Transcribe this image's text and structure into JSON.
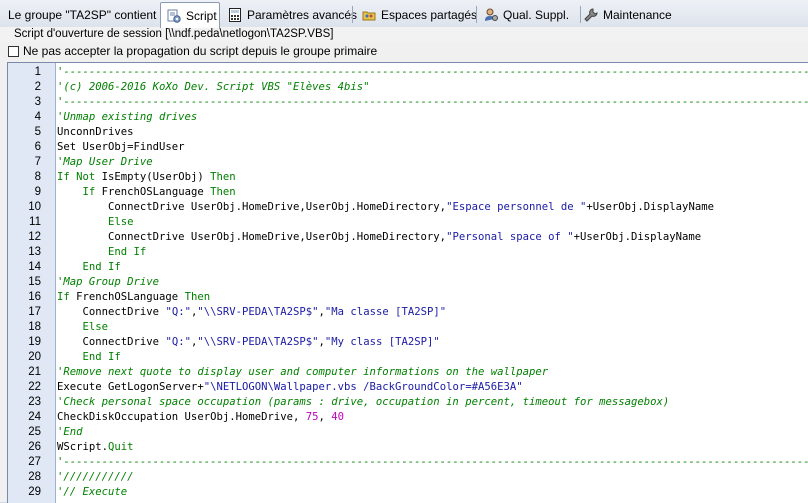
{
  "tabs": [
    {
      "id": "group",
      "label": "Le groupe \"TA2SP\" contient",
      "icon": "none"
    },
    {
      "id": "script",
      "label": "Script",
      "icon": "script-gear-icon",
      "active": true
    },
    {
      "id": "advanced",
      "label": "Paramètres avancés",
      "icon": "calculator-icon"
    },
    {
      "id": "shares",
      "label": "Espaces partagés",
      "icon": "shared-folder-icon"
    },
    {
      "id": "qual",
      "label": "Qual. Suppl.",
      "icon": "user-settings-icon"
    },
    {
      "id": "maintenance",
      "label": "Maintenance",
      "icon": "wrench-icon"
    }
  ],
  "script_path_label": "Script d'ouverture de session [\\\\ndf.peda\\netlogon\\TA2SP.VBS]",
  "propagation_checkbox": {
    "label": "Ne pas accepter la propagation du script depuis le groupe primaire",
    "checked": false
  },
  "colors": {
    "comment": "#008000",
    "keyword": "#008000",
    "string": "#1a1aa6",
    "number": "#c000c0",
    "gutter": "#dfe8f4"
  },
  "code_lines": [
    {
      "n": "1",
      "tokens": [
        [
          "c",
          "'------------------------------------------------------------------------------------------------------------------------------------"
        ]
      ]
    },
    {
      "n": "2",
      "tokens": [
        [
          "c",
          "'(c) 2006-2016 KoXo Dev. Script VBS \"Elèves 4bis\""
        ]
      ]
    },
    {
      "n": "3",
      "tokens": [
        [
          "c",
          "'------------------------------------------------------------------------------------------------------------------------------------"
        ]
      ]
    },
    {
      "n": "4",
      "tokens": [
        [
          "c",
          "'Unmap existing drives"
        ]
      ]
    },
    {
      "n": "5",
      "tokens": [
        [
          "p",
          "UnconnDrives"
        ]
      ]
    },
    {
      "n": "6",
      "tokens": [
        [
          "p",
          "Set UserObj=FindUser"
        ]
      ]
    },
    {
      "n": "7",
      "tokens": [
        [
          "c",
          "'Map User Drive"
        ]
      ]
    },
    {
      "n": "8",
      "tokens": [
        [
          "k",
          "If Not "
        ],
        [
          "p",
          "IsEmpty(UserObj) "
        ],
        [
          "k",
          "Then"
        ]
      ]
    },
    {
      "n": "9",
      "tokens": [
        [
          "k",
          "    If "
        ],
        [
          "p",
          "FrenchOSLanguage "
        ],
        [
          "k",
          "Then"
        ]
      ]
    },
    {
      "n": "10",
      "tokens": [
        [
          "p",
          "        ConnectDrive UserObj.HomeDrive,UserObj.HomeDirectory,"
        ],
        [
          "s",
          "\"Espace personnel de \""
        ],
        [
          "p",
          "+UserObj.DisplayName"
        ]
      ]
    },
    {
      "n": "11",
      "tokens": [
        [
          "k",
          "        Else"
        ]
      ]
    },
    {
      "n": "12",
      "tokens": [
        [
          "p",
          "        ConnectDrive UserObj.HomeDrive,UserObj.HomeDirectory,"
        ],
        [
          "s",
          "\"Personal space of \""
        ],
        [
          "p",
          "+UserObj.DisplayName"
        ]
      ]
    },
    {
      "n": "13",
      "tokens": [
        [
          "k",
          "        End If"
        ]
      ]
    },
    {
      "n": "14",
      "tokens": [
        [
          "k",
          "    End If"
        ]
      ]
    },
    {
      "n": "15",
      "tokens": [
        [
          "c",
          "'Map Group Drive"
        ]
      ]
    },
    {
      "n": "16",
      "tokens": [
        [
          "k",
          "If "
        ],
        [
          "p",
          "FrenchOSLanguage "
        ],
        [
          "k",
          "Then"
        ]
      ]
    },
    {
      "n": "17",
      "tokens": [
        [
          "p",
          "    ConnectDrive "
        ],
        [
          "s",
          "\"Q:\""
        ],
        [
          "p",
          ","
        ],
        [
          "s",
          "\"\\\\SRV-PEDA\\TA2SP$\""
        ],
        [
          "p",
          ","
        ],
        [
          "s",
          "\"Ma classe [TA2SP]\""
        ]
      ]
    },
    {
      "n": "18",
      "tokens": [
        [
          "k",
          "    Else"
        ]
      ]
    },
    {
      "n": "19",
      "tokens": [
        [
          "p",
          "    ConnectDrive "
        ],
        [
          "s",
          "\"Q:\""
        ],
        [
          "p",
          ","
        ],
        [
          "s",
          "\"\\\\SRV-PEDA\\TA2SP$\""
        ],
        [
          "p",
          ","
        ],
        [
          "s",
          "\"My class [TA2SP]\""
        ]
      ]
    },
    {
      "n": "20",
      "tokens": [
        [
          "k",
          "    End If"
        ]
      ]
    },
    {
      "n": "21",
      "tokens": [
        [
          "c",
          "'Remove next quote to display user and computer informations on the wallpaper"
        ]
      ]
    },
    {
      "n": "22",
      "tokens": [
        [
          "p",
          "Execute GetLogonServer+"
        ],
        [
          "s",
          "\"\\NETLOGON\\Wallpaper.vbs /BackGroundColor=#A56E3A\""
        ]
      ]
    },
    {
      "n": "23",
      "tokens": [
        [
          "c",
          "'Check personal space occupation (params : drive, occupation in percent, timeout for messagebox)"
        ]
      ]
    },
    {
      "n": "24",
      "tokens": [
        [
          "p",
          "CheckDiskOccupation UserObj.HomeDrive, "
        ],
        [
          "n",
          "75"
        ],
        [
          "p",
          ", "
        ],
        [
          "n",
          "40"
        ]
      ]
    },
    {
      "n": "25",
      "tokens": [
        [
          "c",
          "'End"
        ]
      ]
    },
    {
      "n": "26",
      "tokens": [
        [
          "p",
          "WScript."
        ],
        [
          "k",
          "Quit"
        ]
      ]
    },
    {
      "n": "27",
      "tokens": [
        [
          "c",
          "'------------------------------------------------------------------------------------------------------------------------------------"
        ]
      ]
    },
    {
      "n": "28",
      "tokens": [
        [
          "c",
          "'///////////"
        ]
      ]
    },
    {
      "n": "29",
      "tokens": [
        [
          "c",
          "'// Execute"
        ]
      ]
    }
  ]
}
